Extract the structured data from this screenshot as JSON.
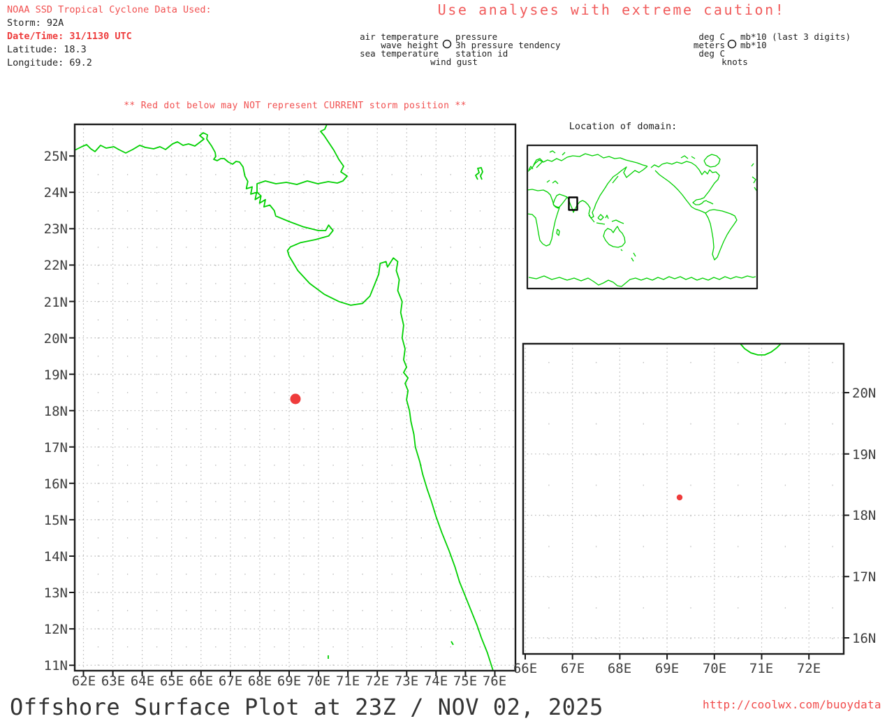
{
  "colors": {
    "red_text": "#f15050",
    "red_bold": "#ee3c3c",
    "coastline_green": "#00d000",
    "storm_dot_red": "#ef3b3b",
    "grid_gray": "#b5b5b5",
    "frame_black": "#1a1a1a",
    "axis_text": "#3d3d3d"
  },
  "header": {
    "line1": "NOAA SSD Tropical Cyclone Data Used:",
    "line2": "Storm: 92A",
    "line3": "Date/Time: 31/1130 UTC",
    "line4": "Latitude: 18.3",
    "line5": "Longitude: 69.2",
    "caution": "Use analyses with extreme caution!"
  },
  "station_legend": {
    "left1": "air temperature",
    "left2": "wave height",
    "left3": "sea temperature",
    "bottom": "wind gust",
    "right1": "pressure",
    "right2": "3h pressure tendency",
    "right3": "station id"
  },
  "units_legend": {
    "left1": "deg C",
    "left2": "meters",
    "left3": "deg C",
    "bottom": "knots",
    "right1": "mb*10 (last 3 digits)",
    "right2": "mb*10"
  },
  "warning": "** Red dot below may NOT represent CURRENT storm position **",
  "domain_inset": {
    "title": "Location of domain:"
  },
  "main_map": {
    "lat_labels": [
      "25N",
      "24N",
      "23N",
      "22N",
      "21N",
      "20N",
      "19N",
      "18N",
      "17N",
      "16N",
      "15N",
      "14N",
      "13N",
      "12N",
      "11N"
    ],
    "lon_labels": [
      "62E",
      "63E",
      "64E",
      "65E",
      "66E",
      "67E",
      "68E",
      "69E",
      "70E",
      "71E",
      "72E",
      "73E",
      "74E",
      "75E",
      "76E"
    ],
    "storm_position": {
      "lon": 69.2,
      "lat": 18.3
    }
  },
  "detail_map": {
    "lat_labels": [
      "20N",
      "19N",
      "18N",
      "17N",
      "16N"
    ],
    "lon_labels": [
      "66E",
      "67E",
      "68E",
      "69E",
      "70E",
      "71E",
      "72E"
    ],
    "storm_position": {
      "lon": 69.2,
      "lat": 18.3
    }
  },
  "footer": {
    "title": "Offshore Surface Plot at 23Z / NOV 02, 2025",
    "url": "http://coolwx.com/buoydata"
  }
}
